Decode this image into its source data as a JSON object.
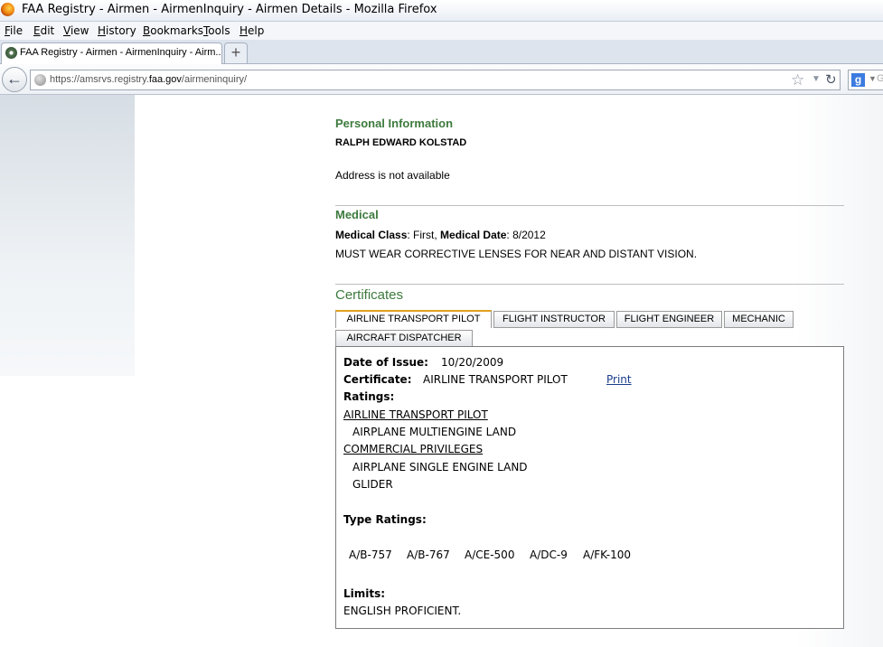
{
  "window": {
    "title": "FAA Registry - Airmen - AirmenInquiry - Airmen Details - Mozilla Firefox"
  },
  "menu": {
    "items": [
      {
        "label": "File",
        "accel": "F",
        "rest": "ile"
      },
      {
        "label": "Edit",
        "accel": "E",
        "rest": "dit"
      },
      {
        "label": "View",
        "accel": "V",
        "rest": "iew"
      },
      {
        "label": "History",
        "accel": "H",
        "rest": "istory"
      },
      {
        "label": "Bookmarks",
        "accel": "B",
        "rest": "ookmarks"
      },
      {
        "label": "Tools",
        "accel": "T",
        "rest": "ools"
      },
      {
        "label": "Help",
        "accel": "H",
        "rest": "elp"
      }
    ]
  },
  "tabs": {
    "active_title": "FAA Registry - Airmen - AirmenInquiry - Airm...",
    "new_tab": "+"
  },
  "nav": {
    "url_prefix": "https://amsrvs.registry.",
    "url_domain": "faa.gov",
    "url_suffix": "/airmeninquiry/",
    "search_placeholder": "G"
  },
  "personal": {
    "heading": "Personal Information",
    "name": "RALPH EDWARD KOLSTAD",
    "address": "Address is not available"
  },
  "medical": {
    "heading": "Medical",
    "class_label": "Medical Class",
    "class_value": ": First, ",
    "date_label": "Medical Date",
    "date_value": ": 8/2012",
    "restriction": "MUST WEAR CORRECTIVE LENSES FOR NEAR AND DISTANT VISION."
  },
  "certificates": {
    "heading": "Certificates",
    "tabs": [
      "AIRLINE TRANSPORT PILOT",
      "FLIGHT INSTRUCTOR",
      "FLIGHT ENGINEER",
      "MECHANIC",
      "AIRCRAFT DISPATCHER"
    ],
    "detail": {
      "issue_label": "Date of Issue:",
      "issue_value": "10/20/2009",
      "cert_label": "Certificate:",
      "cert_value": "AIRLINE TRANSPORT PILOT",
      "print_label": "Print",
      "ratings_label": "Ratings:",
      "rating_groups": [
        {
          "title": "AIRLINE TRANSPORT PILOT",
          "items": [
            "AIRPLANE MULTIENGINE LAND"
          ]
        },
        {
          "title": "COMMERCIAL PRIVILEGES",
          "items": [
            "AIRPLANE SINGLE ENGINE LAND",
            "GLIDER"
          ]
        }
      ],
      "type_ratings_label": "Type Ratings:",
      "type_ratings": [
        "A/B-757",
        "A/B-767",
        "A/CE-500",
        "A/DC-9",
        "A/FK-100"
      ],
      "limits_label": "Limits:",
      "limits_value": "ENGLISH PROFICIENT."
    }
  }
}
